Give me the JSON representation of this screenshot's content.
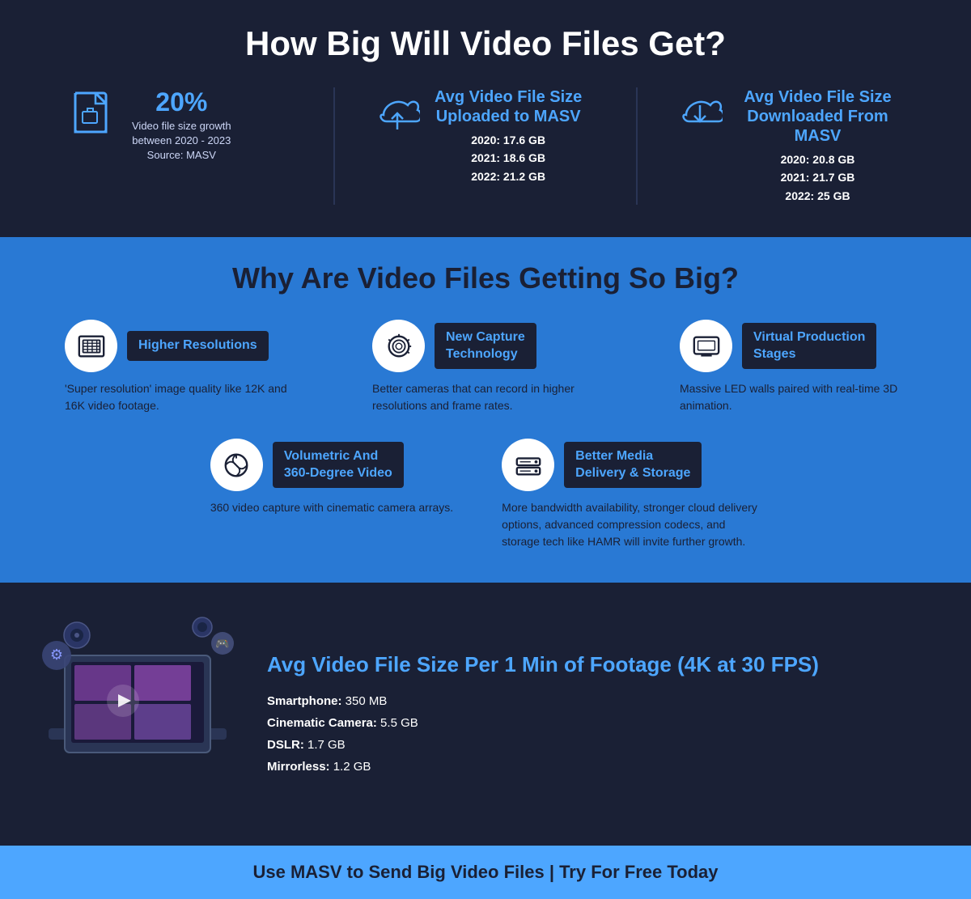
{
  "header": {
    "title": "How Big Will Video Files Get?"
  },
  "stats": {
    "growth": {
      "percent": "20%",
      "desc": "Video file size growth\nbetween 2020 - 2023\nSource: MASV"
    },
    "uploaded": {
      "title": "Avg Video File Size\nUploaded to MASV",
      "2020": "17.6 GB",
      "2021": "18.6 GB",
      "2022": "21.2 GB"
    },
    "downloaded": {
      "title": "Avg Video File Size\nDownloaded From MASV",
      "2020": "20.8 GB",
      "2021": "21.7 GB",
      "2022": "25 GB"
    }
  },
  "why_section": {
    "title": "Why Are Video Files Getting So Big?",
    "reasons": [
      {
        "label": "Higher Resolutions",
        "desc": "'Super resolution' image quality like 12K and 16K video footage."
      },
      {
        "label": "New Capture\nTechnology",
        "desc": "Better cameras that can record in higher resolutions and frame rates."
      },
      {
        "label": "Virtual Production\nStages",
        "desc": "Massive LED walls paired with real-time 3D animation."
      }
    ],
    "reasons2": [
      {
        "label": "Volumetric And\n360-Degree Video",
        "desc": "360 video capture with cinematic camera arrays."
      },
      {
        "label": "Better Media\nDelivery & Storage",
        "desc": "More bandwidth availability, stronger cloud delivery options, advanced compression codecs, and storage tech like HAMR will invite further growth."
      }
    ]
  },
  "avg_size": {
    "title": "Avg Video File Size Per 1 Min of Footage (4K at 30 FPS)",
    "items": [
      {
        "label": "Smartphone:",
        "value": "350 MB"
      },
      {
        "label": "Cinematic Camera:",
        "value": "5.5 GB"
      },
      {
        "label": "DSLR:",
        "value": "1.7 GB"
      },
      {
        "label": "Mirrorless:",
        "value": "1.2 GB"
      }
    ]
  },
  "footer": {
    "text": "Use MASV to Send Big Video Files | Try For Free Today"
  }
}
